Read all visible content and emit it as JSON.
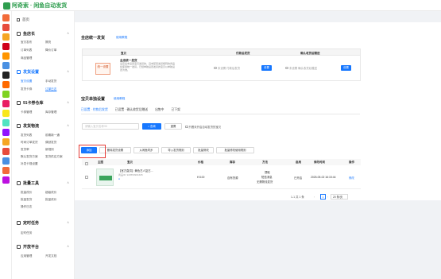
{
  "app": {
    "title": "阿奇索 · 闲鱼自动发货"
  },
  "sidebar": {
    "home": "首页",
    "sections": [
      {
        "title": "鱼店长",
        "items": [
          "宝贝发布",
          "擦亮",
          "订单列表",
          "降价订单",
          "商品管理"
        ]
      },
      {
        "title": "发货设置",
        "items": [
          "宝贝设置",
          "手动发货",
          "发货卡券",
          "订单日志"
        ]
      },
      {
        "title": "91卡券仓库",
        "items": [
          "卡券管理",
          "库存管理"
        ]
      },
      {
        "title": "发货物流",
        "items": [
          "发货列表",
          "前期新一通",
          "时间订单发货",
          "偶然发货",
          "发货率",
          "新规则",
          "默认发货方案",
          "发货供应方案",
          "补发卡规设置"
        ]
      },
      {
        "title": "批量工具",
        "items": [
          "批量改价",
          "超级改价",
          "批量发货",
          "批量改价",
          "操作日志"
        ]
      },
      {
        "title": "定时任务",
        "items": [
          "定时任务"
        ]
      },
      {
        "title": "开放平台",
        "items": [
          "应用管理",
          "开发文档"
        ]
      }
    ]
  },
  "unified": {
    "title": "全店统一发货",
    "help": "使用教程",
    "col_item": "宝贝",
    "col_paid": "付款后发货",
    "col_confirm": "确认收货后赠送",
    "tag": "统一设置",
    "desc_title": "全店统一发货",
    "desc": "设定后未设置宝贝发货的，且未配置发货规则的商品将使用统一发货。已经单独设置发货的宝贝以单独设置为准。",
    "radio_paid": "未设置 付款后发货",
    "radio_confirm": "未设置 确认收货后赠送",
    "set_label": "设置"
  },
  "single": {
    "title": "宝贝单独设置",
    "help": "使用教程",
    "tabs": [
      "已设置 · 付款后发货",
      "已设置 · 确认收货后赠送",
      "出售中",
      "已下架"
    ],
    "search_placeholder": "请输入宝贝名称/ID",
    "search_btn": "查询",
    "reset_btn": "重置",
    "only_unset": "只看未开启自动发货的宝贝",
    "actions": [
      "添加",
      "删除发货设置",
      "从闲鱼同步",
      "导入发货规则",
      "批量修改",
      "批量修改使用规则"
    ],
    "columns": [
      "主图",
      "宝贝",
      "价格",
      "库存",
      "方法",
      "启用",
      "修改时间",
      "操作"
    ],
    "rows": [
      {
        "name": "【官方直供】黄色艺人复古...",
        "sub": "商品ID: 920553961605",
        "sub2": "A",
        "price": "¥ 8.00",
        "stock": "自有货源",
        "method": [
          "提取",
          "短信消息",
          "无需物流发货"
        ],
        "status": "已开启",
        "time": "2025-05-02 16:15:44",
        "op": "修改"
      }
    ],
    "pager": {
      "total": "1-1 共 1 条",
      "current": "1",
      "size": "20 条/页"
    }
  }
}
